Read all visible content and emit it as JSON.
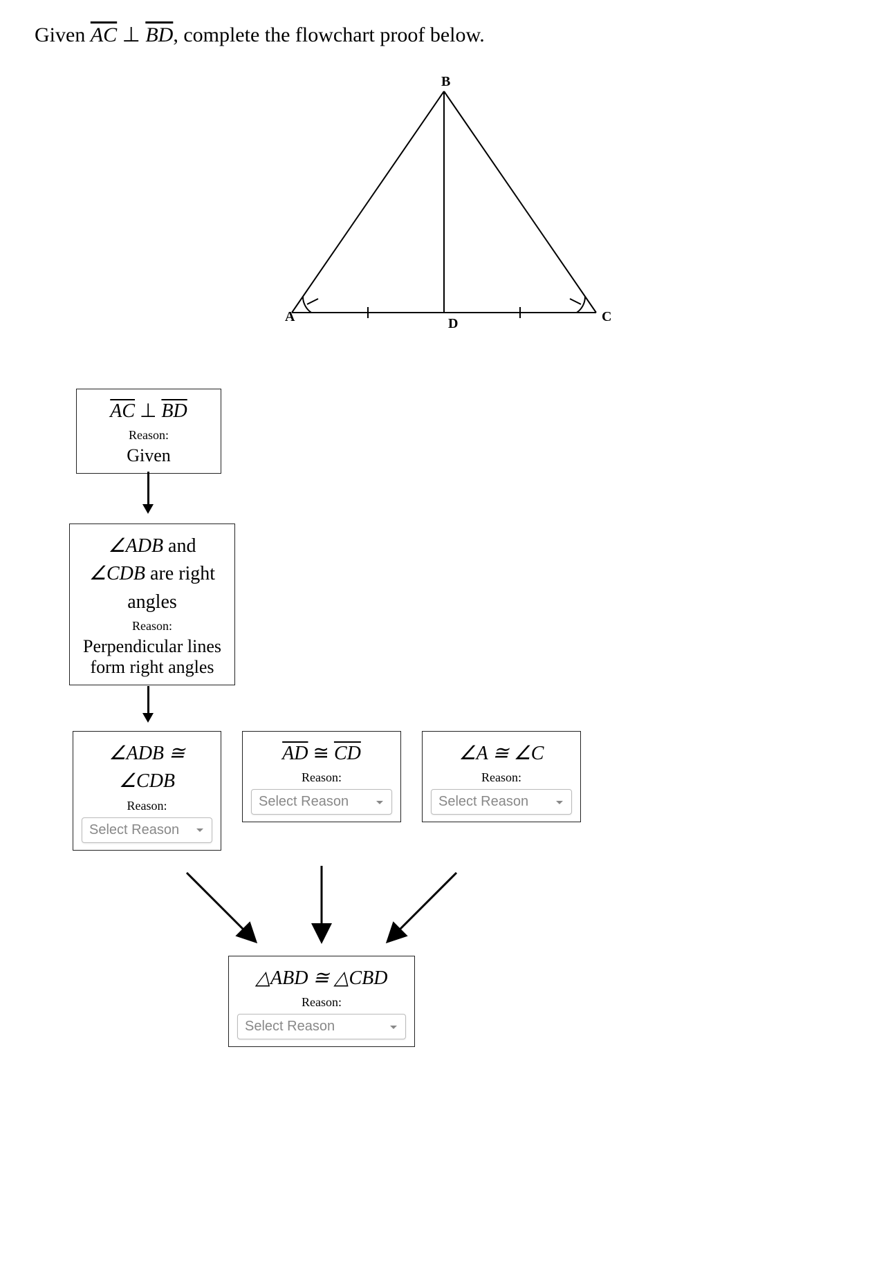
{
  "prompt": {
    "text_before": "Given ",
    "seg1": "AC",
    "perp": " ⊥ ",
    "seg2": "BD",
    "text_after": ", complete the flowchart proof below."
  },
  "diagram": {
    "labels": {
      "A": "A",
      "B": "B",
      "C": "C",
      "D": "D"
    }
  },
  "boxes": {
    "b1": {
      "stmt_seg1": "AC",
      "stmt_perp": " ⊥ ",
      "stmt_seg2": "BD",
      "reason_label": "Reason:",
      "reason": "Given"
    },
    "b2": {
      "line1_pre": "∠ADB",
      "line1_post": " and",
      "line2_pre": "∠CDB",
      "line2_post": " are right",
      "line3": "angles",
      "reason_label": "Reason:",
      "reason_l1": "Perpendicular lines",
      "reason_l2": "form right angles"
    },
    "b3": {
      "line1": "∠ADB ≅",
      "line2": "∠CDB",
      "reason_label": "Reason:",
      "placeholder": "Select Reason"
    },
    "b4": {
      "seg1": "AD",
      "cong": " ≅ ",
      "seg2": "CD",
      "reason_label": "Reason:",
      "placeholder": "Select Reason"
    },
    "b5": {
      "line1": "∠A ≅ ∠C",
      "reason_label": "Reason:",
      "placeholder": "Select Reason"
    },
    "b6": {
      "line1": "△ABD ≅ △CBD",
      "reason_label": "Reason:",
      "placeholder": "Select Reason"
    }
  }
}
